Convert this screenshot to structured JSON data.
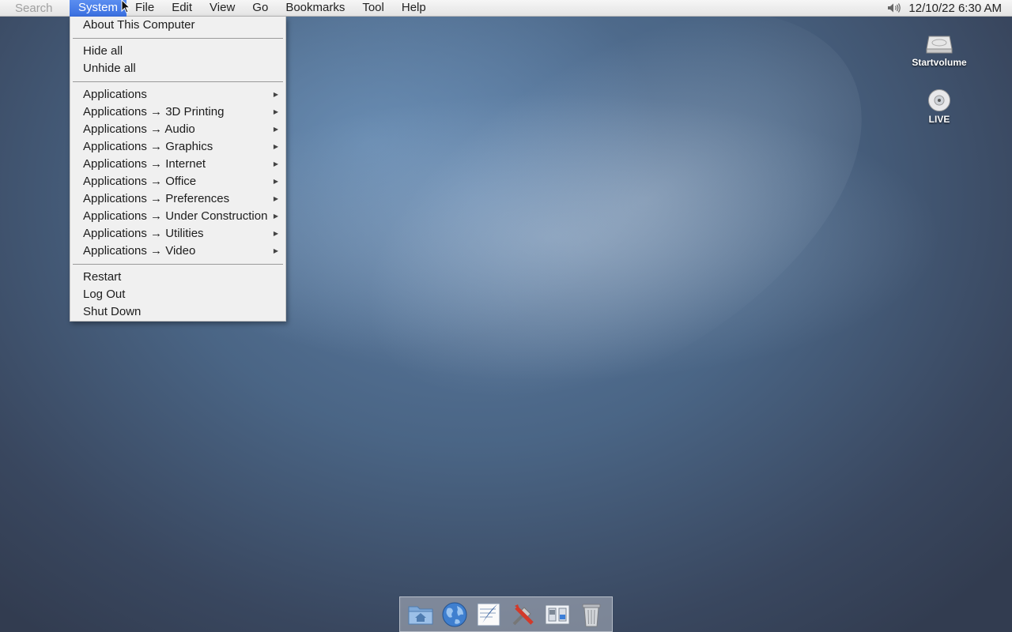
{
  "menubar": {
    "search_placeholder": "Search",
    "menus": [
      "System",
      "File",
      "Edit",
      "View",
      "Go",
      "Bookmarks",
      "Tool",
      "Help"
    ],
    "active_menu": "System",
    "clock": "12/10/22 6:30 AM"
  },
  "system_menu": {
    "about": "About This Computer",
    "hide_all": "Hide all",
    "unhide_all": "Unhide all",
    "applications": [
      "Applications",
      "Applications → 3D Printing",
      "Applications → Audio",
      "Applications → Graphics",
      "Applications → Internet",
      "Applications → Office",
      "Applications → Preferences",
      "Applications → Under Construction",
      "Applications → Utilities",
      "Applications → Video"
    ],
    "restart": "Restart",
    "log_out": "Log Out",
    "shut_down": "Shut Down"
  },
  "desktop_icons": [
    {
      "label": "Startvolume",
      "icon": "hard-drive-icon"
    },
    {
      "label": "LIVE",
      "icon": "optical-disc-icon"
    }
  ],
  "dock": {
    "items": [
      "home-folder-icon",
      "web-browser-icon",
      "text-editor-icon",
      "utilities-icon",
      "preferences-icon",
      "trash-icon"
    ]
  },
  "colors": {
    "menu_highlight": "#3a6fe0",
    "menubar_bg": "#ececec",
    "desktop_blue": "#4a6585"
  }
}
